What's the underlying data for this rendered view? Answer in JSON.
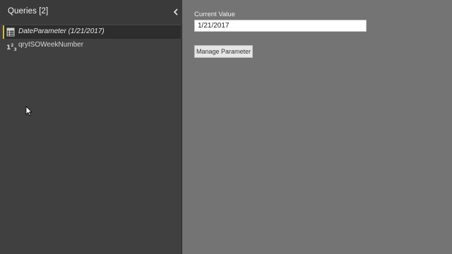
{
  "queries_pane": {
    "title": "Queries [2]",
    "collapse_icon": "chevron-left-icon",
    "items": [
      {
        "label": "DateParameter (1/21/2017)",
        "icon": "table-icon",
        "selected": true
      },
      {
        "label": "qryISOWeekNumber",
        "icon": "number-type-icon",
        "icon_text": "1",
        "selected": false
      }
    ]
  },
  "parameter": {
    "current_value_label": "Current Value",
    "current_value": "1/21/2017",
    "manage_button_label": "Manage Parameter"
  },
  "colors": {
    "pane_bg": "#404040",
    "content_bg": "#747474",
    "selected_accent": "#d8b838"
  }
}
